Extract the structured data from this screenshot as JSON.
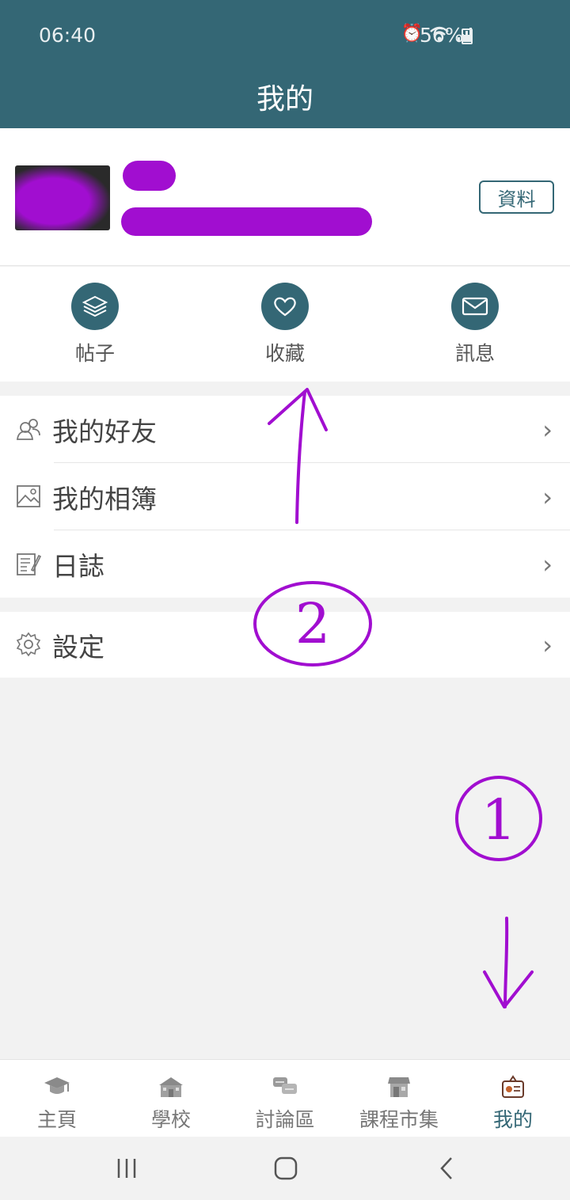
{
  "status": {
    "time": "06:40",
    "battery": "56%"
  },
  "header": {
    "title": "我的"
  },
  "profile": {
    "info_button": "資料"
  },
  "shortcuts": [
    {
      "label": "帖子",
      "icon": "layers-icon"
    },
    {
      "label": "收藏",
      "icon": "heart-icon"
    },
    {
      "label": "訊息",
      "icon": "mail-icon"
    }
  ],
  "menu": [
    {
      "label": "我的好友",
      "icon": "friends-icon"
    },
    {
      "label": "我的相簿",
      "icon": "album-icon"
    },
    {
      "label": "日誌",
      "icon": "journal-icon"
    }
  ],
  "settings": {
    "label": "設定",
    "icon": "gear-icon"
  },
  "bottom_nav": [
    {
      "label": "主頁",
      "icon": "graduation-cap-icon"
    },
    {
      "label": "學校",
      "icon": "school-icon"
    },
    {
      "label": "討論區",
      "icon": "discussion-icon"
    },
    {
      "label": "課程市集",
      "icon": "market-icon"
    },
    {
      "label": "我的",
      "icon": "profile-badge-icon",
      "active": true
    }
  ],
  "annotations": {
    "arrow_up_number": "2",
    "arrow_down_number": "1"
  },
  "colors": {
    "primary": "#346775",
    "annotation": "#a10ed0"
  }
}
